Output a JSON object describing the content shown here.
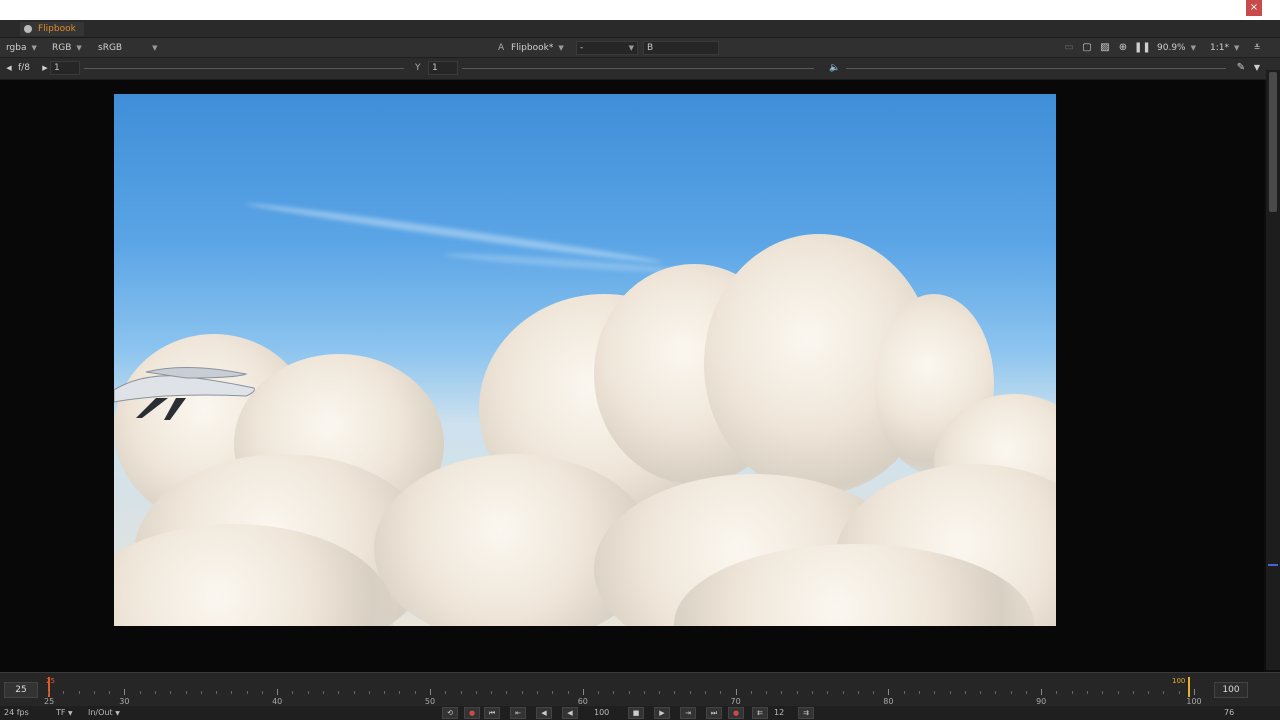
{
  "window": {
    "tab_title": "Flipbook",
    "close_label": "×"
  },
  "toolbar": {
    "channels": "rgba",
    "channel_mode": "RGB",
    "colorspace": "sRGB",
    "input_a_label": "A",
    "input_a_value": "Flipbook*",
    "compare_value": "-",
    "input_b_label": "B",
    "zoom": "90.9%",
    "proxy": "1:1*"
  },
  "toolbar2": {
    "fstop_label": "f/8",
    "gain_value": "1",
    "gamma_label": "Y",
    "gamma_value": "1"
  },
  "timeline": {
    "current_frame": "25",
    "start_frame": "25",
    "end_frame": "100",
    "in_marker": "25",
    "out_marker": "100",
    "end_box": "100",
    "labels": [
      "30",
      "40",
      "50",
      "60",
      "70",
      "80",
      "90",
      "100"
    ]
  },
  "bottombar": {
    "fps": "24 fps",
    "tf": "TF",
    "range_mode": "In/Out",
    "playback_frame": "100",
    "step": "12",
    "frame_count": "76"
  }
}
